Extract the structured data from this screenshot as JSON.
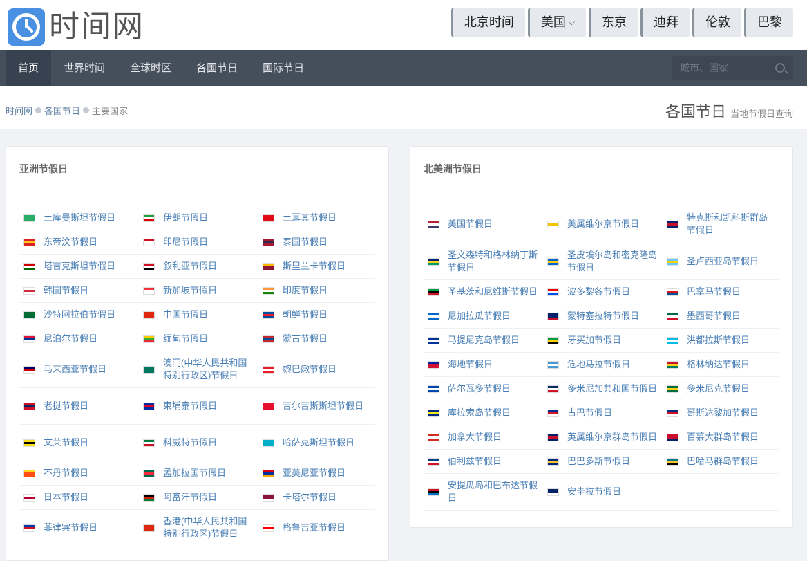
{
  "header": {
    "logo_text": "时间网",
    "city_buttons": [
      "北京时间",
      "美国",
      "东京",
      "迪拜",
      "伦敦",
      "巴黎"
    ],
    "dropdown_caret": "⌵"
  },
  "nav": {
    "items": [
      "首页",
      "世界时间",
      "全球时区",
      "各国节日",
      "国际节日"
    ],
    "active_index": 0,
    "search_placeholder": "城市、国家"
  },
  "breadcrumb": [
    "时间网",
    "各国节日",
    "主要国家"
  ],
  "page_title": {
    "title": "各国节日",
    "subtitle": "当地节假日查询"
  },
  "colors": {
    "link": "#4a7fb5",
    "nav_bg": "#454f5c",
    "accent": "#4a90e2"
  },
  "asia": {
    "title": "亚洲节假日",
    "rows": [
      [
        {
          "name": "土库曼斯坦节假日",
          "flag": [
            "#28ae66",
            "#28ae66",
            "#28ae66"
          ]
        },
        {
          "name": "伊朗节假日",
          "flag": [
            "#239f40",
            "#ffffff",
            "#da0000"
          ]
        },
        {
          "name": "土耳其节假日",
          "flag": [
            "#e30a17",
            "#e30a17",
            "#e30a17"
          ]
        }
      ],
      [
        {
          "name": "东帝汶节假日",
          "flag": [
            "#dc241f",
            "#ffc726",
            "#dc241f"
          ]
        },
        {
          "name": "印尼节假日",
          "flag": [
            "#ce1126",
            "#ffffff",
            "#ffffff"
          ]
        },
        {
          "name": "泰国节假日",
          "flag": [
            "#a51931",
            "#2d2a4a",
            "#a51931"
          ]
        }
      ],
      [
        {
          "name": "塔吉克斯坦节假日",
          "flag": [
            "#cc0000",
            "#ffffff",
            "#006600"
          ]
        },
        {
          "name": "叙利亚节假日",
          "flag": [
            "#ce1126",
            "#ffffff",
            "#000000"
          ]
        },
        {
          "name": "斯里兰卡节假日",
          "flag": [
            "#ffb700",
            "#8d153a",
            "#8d153a"
          ]
        }
      ],
      [
        {
          "name": "韩国节假日",
          "flag": [
            "#ffffff",
            "#cd2e3a",
            "#ffffff"
          ]
        },
        {
          "name": "新加坡节假日",
          "flag": [
            "#ef3340",
            "#ffffff",
            "#ffffff"
          ]
        },
        {
          "name": "印度节假日",
          "flag": [
            "#ff9933",
            "#ffffff",
            "#138808"
          ]
        }
      ],
      [
        {
          "name": "沙特阿拉伯节假日",
          "flag": [
            "#006c35",
            "#006c35",
            "#006c35"
          ]
        },
        {
          "name": "中国节假日",
          "flag": [
            "#de2910",
            "#de2910",
            "#de2910"
          ]
        },
        {
          "name": "朝鲜节假日",
          "flag": [
            "#024fa2",
            "#ed1c27",
            "#024fa2"
          ]
        }
      ],
      [
        {
          "name": "尼泊尔节假日",
          "flag": [
            "#dc143c",
            "#003893",
            "#ffffff"
          ]
        },
        {
          "name": "缅甸节假日",
          "flag": [
            "#fecb00",
            "#34b233",
            "#ea2839"
          ]
        },
        {
          "name": "蒙古节假日",
          "flag": [
            "#c4272f",
            "#015197",
            "#c4272f"
          ]
        }
      ],
      [
        {
          "name": "马来西亚节假日",
          "flag": [
            "#010066",
            "#cc0001",
            "#ffffff"
          ]
        },
        {
          "name": "澳门(中华人民共和国特别行政区)节假日",
          "flag": [
            "#00785e",
            "#00785e",
            "#00785e"
          ]
        },
        {
          "name": "黎巴嫩节假日",
          "flag": [
            "#ed1c24",
            "#ffffff",
            "#ed1c24"
          ]
        }
      ],
      [
        {
          "name": "老挝节假日",
          "flag": [
            "#ce1126",
            "#002868",
            "#ce1126"
          ]
        },
        {
          "name": "柬埔寨节假日",
          "flag": [
            "#032ea1",
            "#e00025",
            "#032ea1"
          ]
        },
        {
          "name": "吉尔吉斯斯坦节假日",
          "flag": [
            "#e8112d",
            "#e8112d",
            "#e8112d"
          ]
        }
      ],
      [
        {
          "name": "文莱节假日",
          "flag": [
            "#f7e017",
            "#000000",
            "#f7e017"
          ]
        },
        {
          "name": "科威特节假日",
          "flag": [
            "#007a3d",
            "#ffffff",
            "#ce1126"
          ]
        },
        {
          "name": "哈萨克斯坦节假日",
          "flag": [
            "#00afca",
            "#00afca",
            "#00afca"
          ]
        }
      ],
      [
        {
          "name": "不丹节假日",
          "flag": [
            "#ffd520",
            "#ff4e12",
            "#ff4e12"
          ]
        },
        {
          "name": "孟加拉国节假日",
          "flag": [
            "#006a4e",
            "#f42a41",
            "#006a4e"
          ]
        },
        {
          "name": "亚美尼亚节假日",
          "flag": [
            "#d90012",
            "#0033a0",
            "#f2a800"
          ]
        }
      ],
      [
        {
          "name": "日本节假日",
          "flag": [
            "#ffffff",
            "#bc002d",
            "#ffffff"
          ]
        },
        {
          "name": "阿富汗节假日",
          "flag": [
            "#000000",
            "#d32011",
            "#007a36"
          ]
        },
        {
          "name": "卡塔尔节假日",
          "flag": [
            "#8a1538",
            "#8a1538",
            "#ffffff"
          ]
        }
      ],
      [
        {
          "name": "菲律宾节假日",
          "flag": [
            "#0038a8",
            "#ce1126",
            "#ffffff"
          ]
        },
        {
          "name": "香港(中华人民共和国特别行政区)节假日",
          "flag": [
            "#de2910",
            "#de2910",
            "#de2910"
          ]
        },
        {
          "name": "格鲁吉亚节假日",
          "flag": [
            "#ffffff",
            "#ff0000",
            "#ffffff"
          ]
        }
      ]
    ]
  },
  "north_america": {
    "title": "北美洲节假日",
    "rows": [
      [
        {
          "name": "美国节假日",
          "flag": [
            "#b22234",
            "#ffffff",
            "#3c3b6e"
          ]
        },
        {
          "name": "美属维尔京节假日",
          "flag": [
            "#ffffff",
            "#f4c300",
            "#ffffff"
          ]
        },
        {
          "name": "特克斯和凯科斯群岛节假日",
          "flag": [
            "#012169",
            "#c8102e",
            "#012169"
          ]
        }
      ],
      [
        {
          "name": "圣文森特和格林纳丁斯节假日",
          "flag": [
            "#002674",
            "#fcd116",
            "#009e60"
          ]
        },
        {
          "name": "圣皮埃尔岛和密克隆岛节假日",
          "flag": [
            "#0066cc",
            "#ffcc00",
            "#0066cc"
          ]
        },
        {
          "name": "圣卢西亚岛节假日",
          "flag": [
            "#66ccff",
            "#ffce00",
            "#66ccff"
          ]
        }
      ],
      [
        {
          "name": "圣基茨和尼维斯节假日",
          "flag": [
            "#009e49",
            "#000000",
            "#ce1126"
          ]
        },
        {
          "name": "波多黎各节假日",
          "flag": [
            "#ed0000",
            "#ffffff",
            "#0050f0"
          ]
        },
        {
          "name": "巴拿马节假日",
          "flag": [
            "#ffffff",
            "#da121a",
            "#005293"
          ]
        }
      ],
      [
        {
          "name": "尼加拉瓜节假日",
          "flag": [
            "#0067c6",
            "#ffffff",
            "#0067c6"
          ]
        },
        {
          "name": "蒙特塞拉特节假日",
          "flag": [
            "#012169",
            "#012169",
            "#c8102e"
          ]
        },
        {
          "name": "墨西哥节假日",
          "flag": [
            "#006847",
            "#ffffff",
            "#ce1126"
          ]
        }
      ],
      [
        {
          "name": "马提尼克岛节假日",
          "flag": [
            "#003399",
            "#ffffff",
            "#003399"
          ]
        },
        {
          "name": "牙买加节假日",
          "flag": [
            "#009b3a",
            "#fed100",
            "#000000"
          ]
        },
        {
          "name": "洪都拉斯节假日",
          "flag": [
            "#00bce4",
            "#ffffff",
            "#00bce4"
          ]
        }
      ],
      [
        {
          "name": "海地节假日",
          "flag": [
            "#00209f",
            "#d21034",
            "#d21034"
          ]
        },
        {
          "name": "危地马拉节假日",
          "flag": [
            "#4997d0",
            "#ffffff",
            "#4997d0"
          ]
        },
        {
          "name": "格林纳达节假日",
          "flag": [
            "#ce1126",
            "#fcd116",
            "#007a5e"
          ]
        }
      ],
      [
        {
          "name": "萨尔瓦多节假日",
          "flag": [
            "#0047ab",
            "#ffffff",
            "#0047ab"
          ]
        },
        {
          "name": "多米尼加共和国节假日",
          "flag": [
            "#002d62",
            "#ffffff",
            "#ce1126"
          ]
        },
        {
          "name": "多米尼克节假日",
          "flag": [
            "#006b3f",
            "#fcd116",
            "#006b3f"
          ]
        }
      ],
      [
        {
          "name": "库拉索岛节假日",
          "flag": [
            "#002b7f",
            "#f9e814",
            "#002b7f"
          ]
        },
        {
          "name": "古巴节假日",
          "flag": [
            "#002a8f",
            "#cf142b",
            "#ffffff"
          ]
        },
        {
          "name": "哥斯达黎加节假日",
          "flag": [
            "#002b7f",
            "#ce1126",
            "#ffffff"
          ]
        }
      ],
      [
        {
          "name": "加拿大节假日",
          "flag": [
            "#d52b1e",
            "#ffffff",
            "#d52b1e"
          ]
        },
        {
          "name": "英属维尔京群岛节假日",
          "flag": [
            "#012169",
            "#c8102e",
            "#012169"
          ]
        },
        {
          "name": "百慕大群岛节假日",
          "flag": [
            "#c8102e",
            "#c8102e",
            "#012169"
          ]
        }
      ],
      [
        {
          "name": "伯利兹节假日",
          "flag": [
            "#003f87",
            "#ffffff",
            "#ce1126"
          ]
        },
        {
          "name": "巴巴多斯节假日",
          "flag": [
            "#00267f",
            "#ffc726",
            "#00267f"
          ]
        },
        {
          "name": "巴哈马群岛节假日",
          "flag": [
            "#00778b",
            "#ffc72c",
            "#000000"
          ]
        }
      ],
      [
        {
          "name": "安提瓜岛和巴布达节假日",
          "flag": [
            "#ce1126",
            "#000000",
            "#0072c6"
          ]
        },
        {
          "name": "安圭拉节假日",
          "flag": [
            "#012169",
            "#012169",
            "#ffffff"
          ]
        }
      ]
    ]
  }
}
